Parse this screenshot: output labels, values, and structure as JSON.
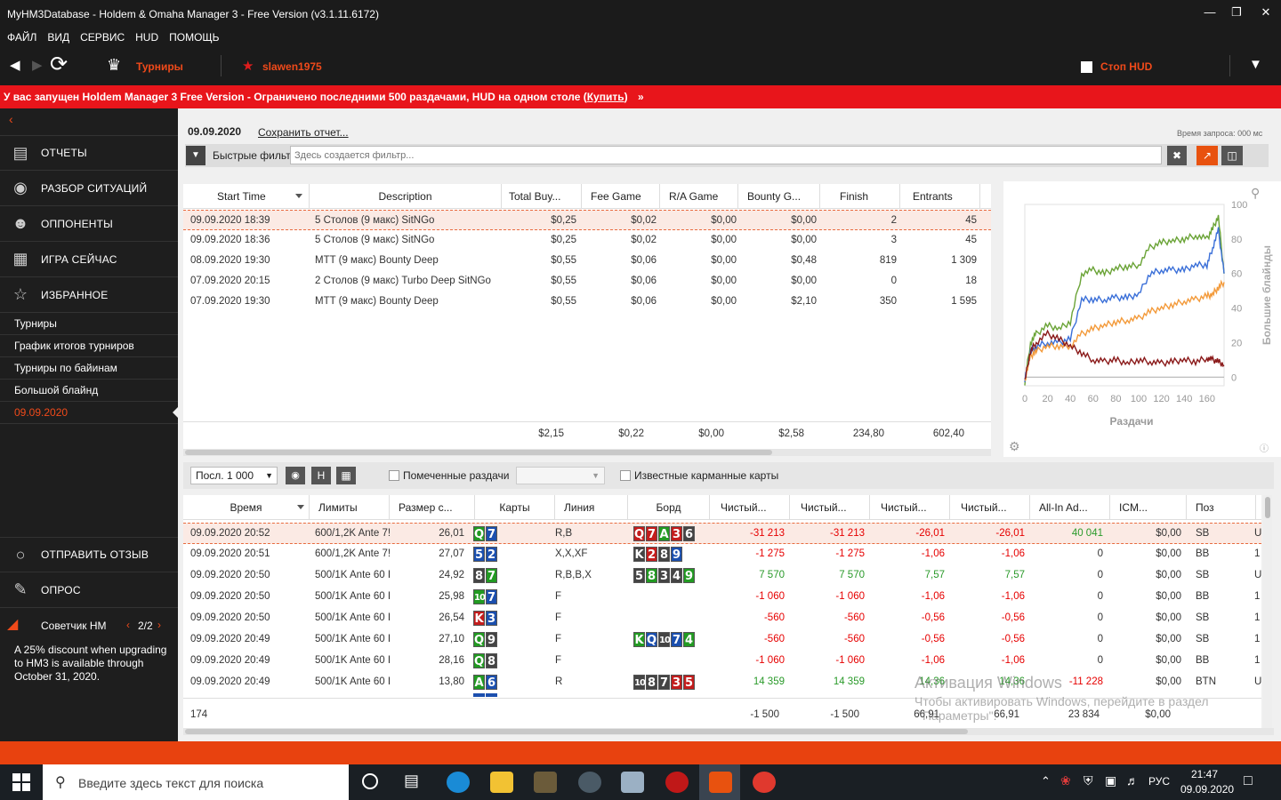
{
  "window": {
    "title": "MyHM3Database - Holdem & Omaha Manager 3 - Free Version (v3.1.11.6172)"
  },
  "menu": [
    "Файл",
    "Вид",
    "Сервис",
    "HUD",
    "Помощь"
  ],
  "toolbar": {
    "tournaments": "Турниры",
    "player": "slawen1975",
    "stop_hud": "Стоп HUD"
  },
  "banner": {
    "text": "У вас запущен Holdem Manager 3 Free Version - Ограничено последними 500 раздачами, HUD на одном столе (",
    "link": "Купить",
    "tail": ")"
  },
  "sidebar": {
    "nav": [
      "Отчеты",
      "Разбор ситуаций",
      "Оппоненты",
      "Игра сейчас",
      "Избранное"
    ],
    "sub": [
      "Турниры",
      "График итогов турниров",
      "Турниры по байинам",
      "Большой блайнд",
      "09.09.2020"
    ],
    "bottom": [
      "Отправить отзыв",
      "Опрос"
    ],
    "advisor": {
      "label": "Советчик HM",
      "page": "2/2",
      "text": "A 25% discount when upgrading to HM3 is available through October 31, 2020."
    }
  },
  "report": {
    "date": "09.09.2020",
    "save": "Сохранить отчет...",
    "query_time": "Время запроса: 000 мс",
    "quick_filter": "Быстрые фильт",
    "filter_placeholder": "Здесь создается фильтр..."
  },
  "tourney_table": {
    "headers": [
      "Start Time",
      "Description",
      "Total Buy...",
      "Fee Game",
      "R/A Game",
      "Bounty G...",
      "Finish",
      "Entrants"
    ],
    "rows": [
      [
        "09.09.2020 18:39",
        "5 Столов (9 макс) SitNGo",
        "$0,25",
        "$0,02",
        "$0,00",
        "$0,00",
        "2",
        "45"
      ],
      [
        "09.09.2020 18:36",
        "5 Столов (9 макс) SitNGo",
        "$0,25",
        "$0,02",
        "$0,00",
        "$0,00",
        "3",
        "45"
      ],
      [
        "08.09.2020 19:30",
        "MTT (9 макс) Bounty Deep",
        "$0,55",
        "$0,06",
        "$0,00",
        "$0,48",
        "819",
        "1 309"
      ],
      [
        "07.09.2020 20:15",
        "2 Столов (9 макс) Turbo Deep SitNGo",
        "$0,55",
        "$0,06",
        "$0,00",
        "$0,00",
        "0",
        "18"
      ],
      [
        "07.09.2020 19:30",
        "MTT (9 макс) Bounty Deep",
        "$0,55",
        "$0,06",
        "$0,00",
        "$2,10",
        "350",
        "1 595"
      ]
    ],
    "totals": [
      "$2,15",
      "$0,22",
      "$0,00",
      "$2,58",
      "234,80",
      "602,40"
    ]
  },
  "chart_data": {
    "type": "line",
    "xlabel": "Раздачи",
    "ylabel": "Большие блайнды",
    "x_ticks": [
      "0",
      "20",
      "40",
      "60",
      "80",
      "100",
      "120",
      "140",
      "160"
    ],
    "y_ticks": [
      "0",
      "20",
      "40",
      "60",
      "80",
      "100"
    ],
    "xlim": [
      0,
      175
    ],
    "ylim": [
      -5,
      100
    ],
    "series": [
      {
        "color": "#6aa336",
        "x": [
          0,
          5,
          10,
          20,
          30,
          40,
          50,
          60,
          70,
          80,
          90,
          100,
          110,
          120,
          130,
          140,
          150,
          160,
          165,
          170,
          175
        ],
        "y": [
          -3,
          20,
          25,
          30,
          28,
          32,
          60,
          62,
          60,
          63,
          64,
          65,
          75,
          78,
          79,
          80,
          82,
          80,
          86,
          93,
          60
        ]
      },
      {
        "color": "#3a6fd8",
        "x": [
          0,
          5,
          10,
          20,
          30,
          40,
          50,
          60,
          70,
          80,
          90,
          100,
          110,
          120,
          130,
          140,
          150,
          160,
          165,
          170,
          175
        ],
        "y": [
          -2,
          15,
          18,
          20,
          20,
          22,
          45,
          45,
          45,
          46,
          46,
          48,
          60,
          62,
          62,
          62,
          65,
          65,
          75,
          85,
          60
        ]
      },
      {
        "color": "#f39a3a",
        "x": [
          0,
          5,
          10,
          20,
          30,
          40,
          50,
          60,
          70,
          80,
          90,
          100,
          110,
          120,
          130,
          140,
          150,
          160,
          165,
          170,
          175
        ],
        "y": [
          -2,
          12,
          15,
          18,
          18,
          18,
          25,
          28,
          30,
          32,
          33,
          34,
          38,
          40,
          42,
          44,
          45,
          47,
          48,
          52,
          55
        ]
      },
      {
        "color": "#8b1b1b",
        "x": [
          0,
          5,
          10,
          20,
          30,
          40,
          50,
          60,
          70,
          80,
          90,
          100,
          110,
          120,
          130,
          140,
          150,
          160,
          165,
          170,
          175
        ],
        "y": [
          -2,
          15,
          20,
          25,
          22,
          18,
          14,
          10,
          9,
          10,
          8,
          10,
          9,
          8,
          9,
          10,
          9,
          11,
          10,
          9,
          7
        ]
      }
    ]
  },
  "hand_controls": {
    "last": "Посл. 1 000",
    "marked": "Помеченные раздачи",
    "known": "Известные карманные карты",
    "h": "H"
  },
  "hand_table": {
    "headers": [
      "Время",
      "Лимиты",
      "Размер с...",
      "Карты",
      "Линия",
      "Борд",
      "Чистый...",
      "Чистый...",
      "Чистый...",
      "Чистый...",
      "All-In Ad...",
      "ICM...",
      "Поз"
    ],
    "rows": [
      {
        "time": "09.09.2020 20:52",
        "limit": "600/1,2K Ante 7!",
        "size": "26,01",
        "cards": [
          [
            "Q",
            "c"
          ],
          [
            "7",
            "d"
          ]
        ],
        "line": "R,B",
        "board": [
          [
            "Q",
            "h"
          ],
          [
            "7",
            "h"
          ],
          [
            "A",
            "c"
          ],
          [
            "3",
            "h"
          ],
          [
            "6",
            "s"
          ]
        ],
        "n1": "-31 213",
        "n2": "-31 213",
        "n3": "-26,01",
        "n4": "-26,01",
        "ai": "40 041",
        "icm": "$0,00",
        "pos": "SB",
        "x": "U"
      },
      {
        "time": "09.09.2020 20:51",
        "limit": "600/1,2K Ante 7!",
        "size": "27,07",
        "cards": [
          [
            "5",
            "d"
          ],
          [
            "2",
            "d"
          ]
        ],
        "line": "X,X,XF",
        "board": [
          [
            "K",
            "s"
          ],
          [
            "2",
            "h"
          ],
          [
            "8",
            "s"
          ],
          [
            "9",
            "d"
          ]
        ],
        "n1": "-1 275",
        "n2": "-1 275",
        "n3": "-1,06",
        "n4": "-1,06",
        "ai": "0",
        "icm": "$0,00",
        "pos": "BB",
        "x": "1"
      },
      {
        "time": "09.09.2020 20:50",
        "limit": "500/1K Ante 60 I",
        "size": "24,92",
        "cards": [
          [
            "8",
            "s"
          ],
          [
            "7",
            "c"
          ]
        ],
        "line": "R,B,B,X",
        "board": [
          [
            "5",
            "s"
          ],
          [
            "8",
            "c"
          ],
          [
            "3",
            "s"
          ],
          [
            "4",
            "s"
          ],
          [
            "9",
            "c"
          ]
        ],
        "n1": "7 570",
        "n2": "7 570",
        "n3": "7,57",
        "n4": "7,57",
        "ai": "0",
        "icm": "$0,00",
        "pos": "SB",
        "x": "U"
      },
      {
        "time": "09.09.2020 20:50",
        "limit": "500/1K Ante 60 I",
        "size": "25,98",
        "cards": [
          [
            "10",
            "c"
          ],
          [
            "7",
            "d"
          ]
        ],
        "line": "F",
        "board": [],
        "n1": "-1 060",
        "n2": "-1 060",
        "n3": "-1,06",
        "n4": "-1,06",
        "ai": "0",
        "icm": "$0,00",
        "pos": "BB",
        "x": "1"
      },
      {
        "time": "09.09.2020 20:50",
        "limit": "500/1K Ante 60 I",
        "size": "26,54",
        "cards": [
          [
            "K",
            "h"
          ],
          [
            "3",
            "d"
          ]
        ],
        "line": "F",
        "board": [],
        "n1": "-560",
        "n2": "-560",
        "n3": "-0,56",
        "n4": "-0,56",
        "ai": "0",
        "icm": "$0,00",
        "pos": "SB",
        "x": "1"
      },
      {
        "time": "09.09.2020 20:49",
        "limit": "500/1K Ante 60 I",
        "size": "27,10",
        "cards": [
          [
            "Q",
            "c"
          ],
          [
            "9",
            "s"
          ]
        ],
        "line": "F",
        "board": [
          [
            "K",
            "c"
          ],
          [
            "Q",
            "d"
          ],
          [
            "10",
            "s"
          ],
          [
            "7",
            "d"
          ],
          [
            "4",
            "c"
          ]
        ],
        "n1": "-560",
        "n2": "-560",
        "n3": "-0,56",
        "n4": "-0,56",
        "ai": "0",
        "icm": "$0,00",
        "pos": "SB",
        "x": "1"
      },
      {
        "time": "09.09.2020 20:49",
        "limit": "500/1K Ante 60 I",
        "size": "28,16",
        "cards": [
          [
            "Q",
            "c"
          ],
          [
            "8",
            "s"
          ]
        ],
        "line": "F",
        "board": [],
        "n1": "-1 060",
        "n2": "-1 060",
        "n3": "-1,06",
        "n4": "-1,06",
        "ai": "0",
        "icm": "$0,00",
        "pos": "BB",
        "x": "1"
      },
      {
        "time": "09.09.2020 20:49",
        "limit": "500/1K Ante 60 I",
        "size": "13,80",
        "cards": [
          [
            "A",
            "c"
          ],
          [
            "6",
            "d"
          ]
        ],
        "line": "R",
        "board": [
          [
            "10",
            "s"
          ],
          [
            "8",
            "s"
          ],
          [
            "7",
            "s"
          ],
          [
            "3",
            "h"
          ],
          [
            "5",
            "h"
          ]
        ],
        "n1": "14 359",
        "n2": "14 359",
        "n3": "14,36",
        "n4": "14,36",
        "ai": "-11 228",
        "icm": "$0,00",
        "pos": "BTN",
        "x": "U"
      }
    ],
    "totals": {
      "count": "174",
      "n1": "-1 500",
      "n2": "-1 500",
      "n3": "66,91",
      "n4": "66,91",
      "ai": "23 834",
      "icm": "$0,00"
    }
  },
  "watermark": {
    "line1": "Активация Windows",
    "line2": "Чтобы активировать Windows, перейдите в раздел",
    "line3": "\"Параметры\"."
  },
  "taskbar": {
    "search": "Введите здесь текст для поиска",
    "lang": "РУС",
    "time": "21:47",
    "date": "09.09.2020"
  }
}
